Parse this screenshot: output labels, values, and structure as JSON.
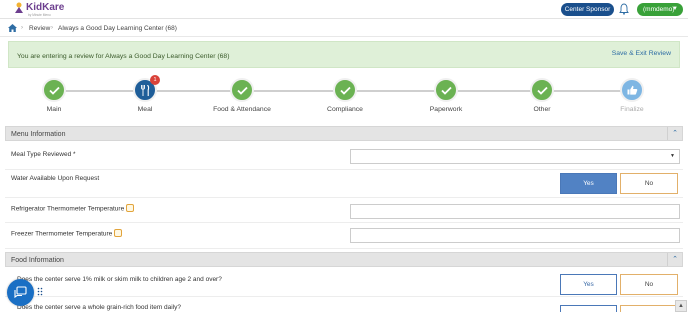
{
  "header": {
    "brand": "KidKare",
    "tagline": "by Minute Menu",
    "center_sponsor_label": "Center Sponsor",
    "user_label": "(mmdemo)"
  },
  "breadcrumb": {
    "items": [
      "Review",
      "Always a Good Day Learning Center (68)"
    ]
  },
  "banner": {
    "message": "You are entering a review for Always a Good Day Learning Center (68)",
    "save_exit_label": "Save & Exit Review"
  },
  "steps": [
    {
      "label": "Main",
      "status": "done"
    },
    {
      "label": "Meal",
      "status": "active",
      "badge": "1"
    },
    {
      "label": "Food & Attendance",
      "status": "done"
    },
    {
      "label": "Compliance",
      "status": "done"
    },
    {
      "label": "Paperwork",
      "status": "done"
    },
    {
      "label": "Other",
      "status": "done"
    },
    {
      "label": "Finalize",
      "status": "pending"
    }
  ],
  "menu_info": {
    "title": "Menu Information",
    "meal_type_label": "Meal Type Reviewed *",
    "meal_type_value": "",
    "water_label": "Water Available Upon Request",
    "yes_label": "Yes",
    "no_label": "No",
    "fridge_label": "Refrigerator Thermometer Temperature",
    "freezer_label": "Freezer Thermometer Temperature"
  },
  "food_info": {
    "title": "Food Information",
    "milk_question": "Does the center serve 1% milk or skim milk to children age 2 and over?",
    "grain_question": "Does the center serve a whole grain-rich food item daily?"
  },
  "colors": {
    "done": "#6bb253",
    "active": "#1f5e99",
    "pending": "#7eb6e3",
    "accent_blue": "#1a4f8c",
    "user_green": "#39a139"
  }
}
